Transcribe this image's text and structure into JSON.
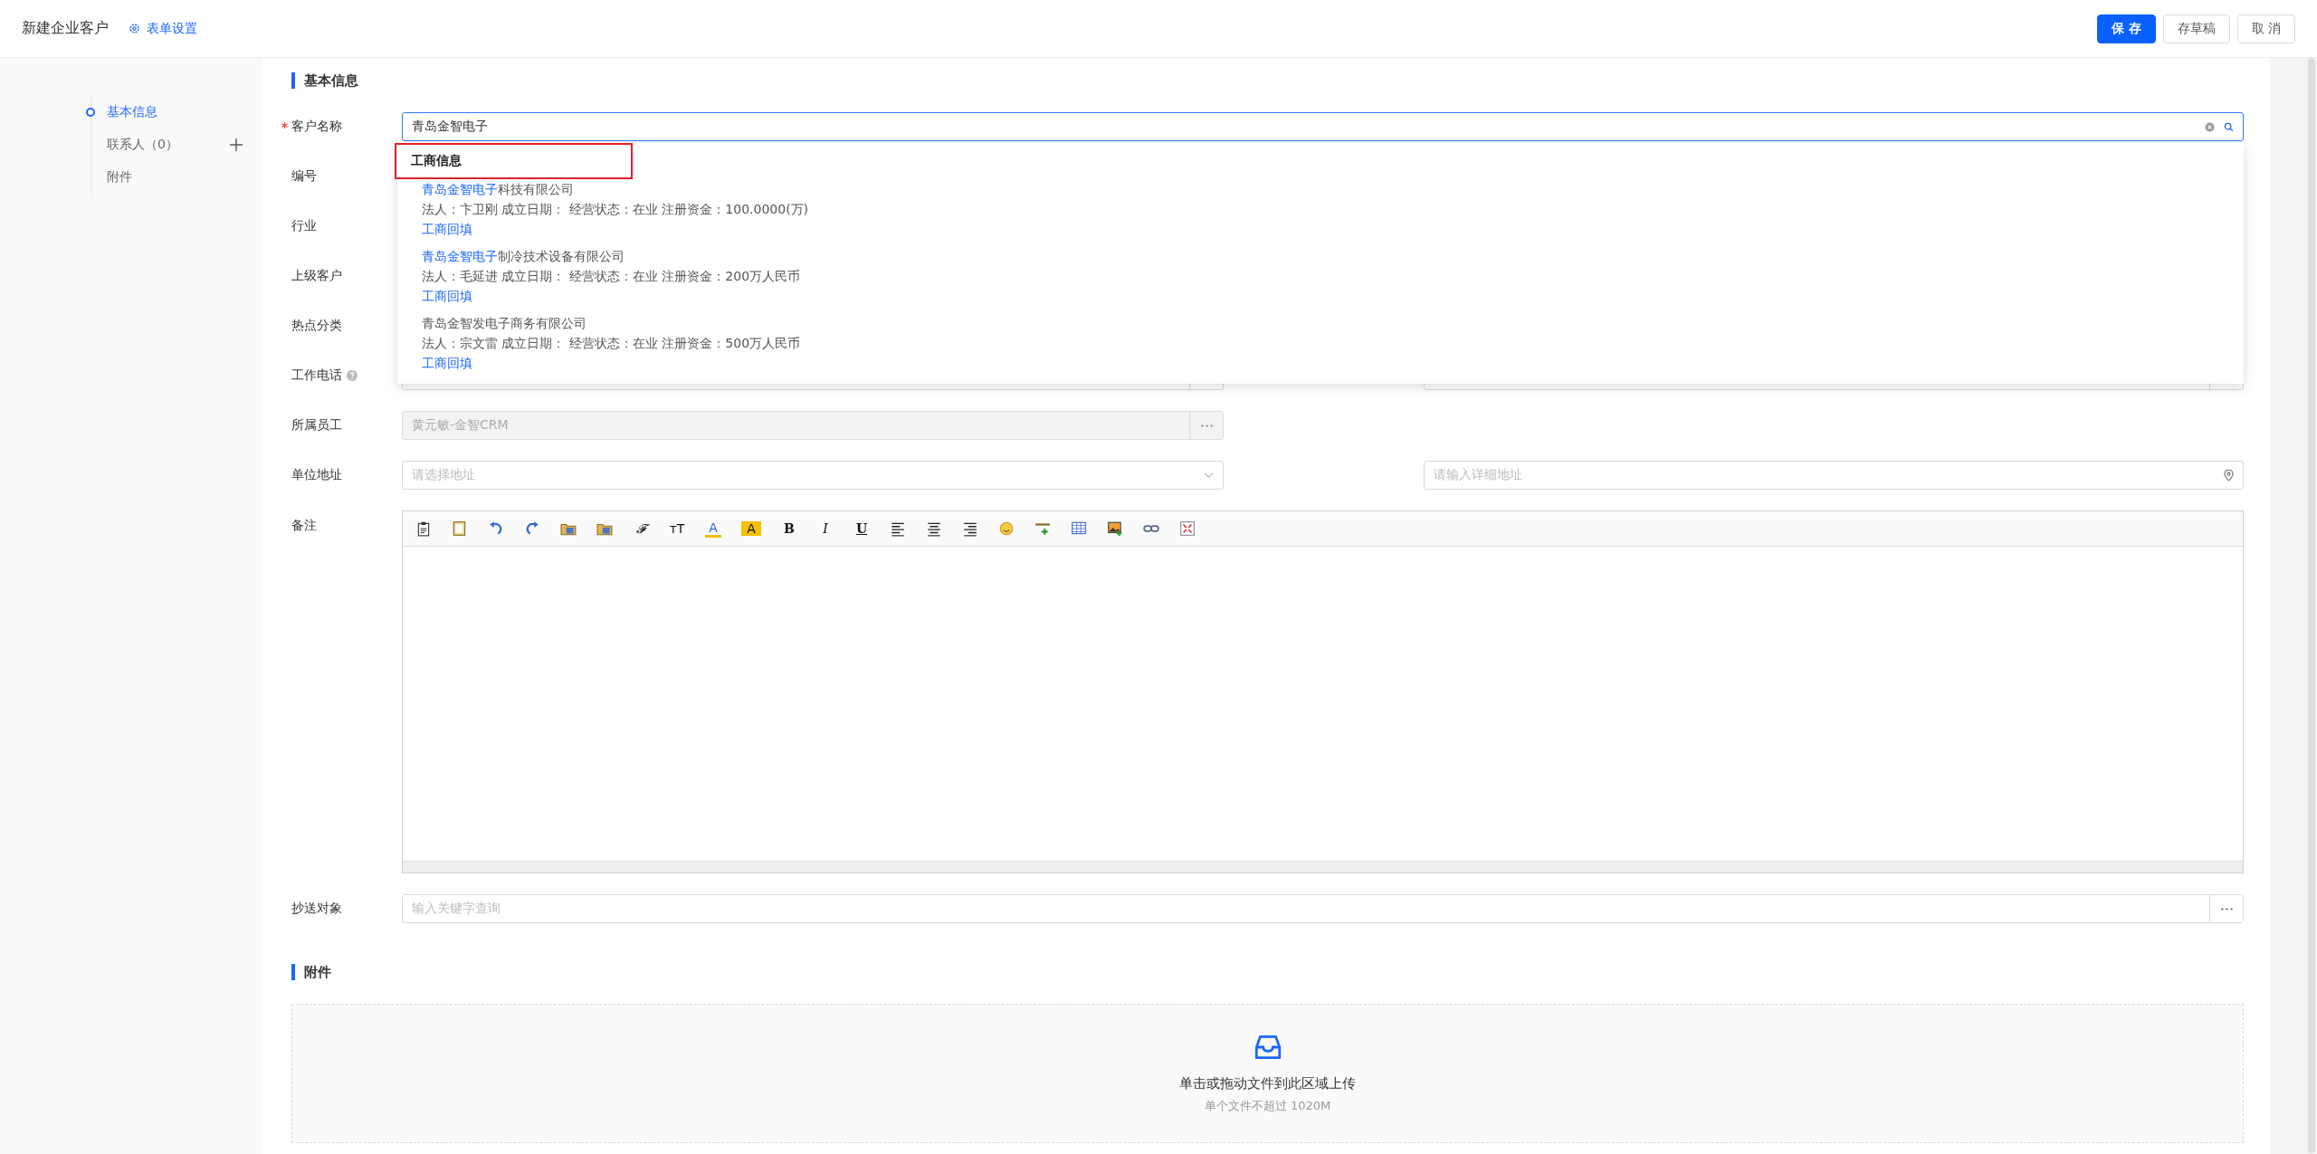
{
  "header": {
    "title": "新建企业客户",
    "link": "表单设置",
    "buttons": [
      {
        "label": "保 存",
        "kind": "primary"
      },
      {
        "label": "存草稿",
        "kind": "default"
      },
      {
        "label": "取 消",
        "kind": "default"
      }
    ]
  },
  "nav": [
    {
      "label": "基本信息",
      "selected": true,
      "addable": false
    },
    {
      "label": "联系人（0）",
      "selected": false,
      "addable": true
    },
    {
      "label": "附件",
      "selected": false,
      "addable": false
    }
  ],
  "basic": {
    "title": "基本信息",
    "rows": [
      {
        "label": "客户名称",
        "required": true,
        "help": false,
        "kind": "search",
        "value": "青岛金智电子",
        "focused": true
      },
      {
        "label": "编号",
        "required": false,
        "help": false,
        "kind": "covered"
      },
      {
        "label": "行业",
        "required": false,
        "help": false,
        "kind": "covered"
      },
      {
        "label": "上级客户",
        "required": false,
        "help": false,
        "kind": "covered"
      },
      {
        "label": "热点分类",
        "required": false,
        "help": false,
        "kind": "covered"
      },
      {
        "label": "工作电话",
        "required": false,
        "help": true,
        "kind": "pair-covered"
      },
      {
        "label": "所属员工",
        "required": false,
        "help": false,
        "kind": "picker",
        "value": "黄元敏-金智CRM",
        "disabled": true
      },
      {
        "label": "单位地址",
        "required": false,
        "help": false,
        "kind": "address",
        "placeholder": "请选择地址",
        "detail_placeholder": "请输入详细地址"
      },
      {
        "label": "备注",
        "required": false,
        "help": false,
        "kind": "editor"
      },
      {
        "label": "抄送对象",
        "required": false,
        "help": false,
        "kind": "search-picker",
        "placeholder": "输入关键字查询"
      }
    ],
    "suggestions": {
      "header": "工商信息",
      "outlined": true,
      "items": [
        {
          "match": "青岛金智电子",
          "rest": "科技有限公司",
          "details": "法人：卞卫刚 成立日期： 经营状态：在业 注册资金：100.0000(万)",
          "action": "工商回填"
        },
        {
          "match": "青岛金智电子",
          "rest": "制冷技术设备有限公司",
          "details": "法人：毛延进 成立日期： 经营状态：在业 注册资金：200万人民币",
          "action": "工商回填"
        },
        {
          "rest": "青岛金智发电子商务有限公司",
          "details": "法人：宗文雷 成立日期： 经营状态：在业 注册资金：500万人民币",
          "action": "工商回填"
        }
      ]
    }
  },
  "toolbar": [
    {
      "kind": "clipboard"
    },
    {
      "kind": "document"
    },
    {
      "kind": "undo"
    },
    {
      "kind": "redo"
    },
    {
      "kind": "folder"
    },
    {
      "kind": "folder"
    },
    {
      "kind": "font-family",
      "glyph": "𝓕"
    },
    {
      "kind": "font-size",
      "glyph": "тT"
    },
    {
      "kind": "font-color",
      "glyph": "A"
    },
    {
      "kind": "highlight",
      "glyph": "A"
    },
    {
      "kind": "bold",
      "glyph": "B"
    },
    {
      "kind": "italic",
      "glyph": "I"
    },
    {
      "kind": "underline",
      "glyph": "U"
    },
    {
      "kind": "align-left"
    },
    {
      "kind": "align-center"
    },
    {
      "kind": "align-right"
    },
    {
      "kind": "smiley"
    },
    {
      "kind": "rule"
    },
    {
      "kind": "table"
    },
    {
      "kind": "image"
    },
    {
      "kind": "link"
    },
    {
      "kind": "fullscreen"
    }
  ],
  "attachments": {
    "title": "附件",
    "prompt": "单击或拖动文件到此区域上传",
    "hint": "单个文件不超过 1020M"
  }
}
